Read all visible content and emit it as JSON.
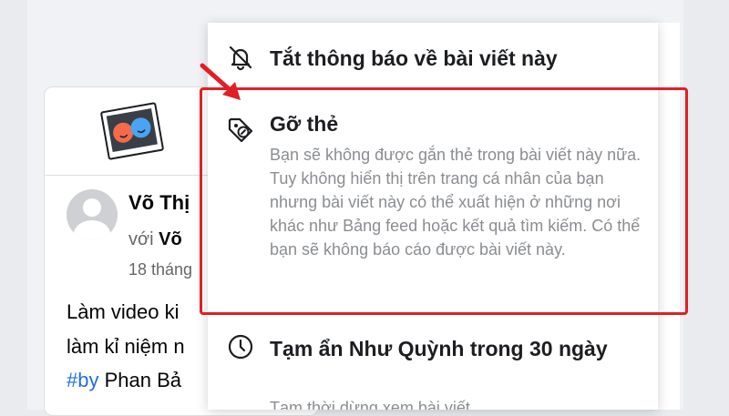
{
  "post": {
    "author": "Võ Thị",
    "with_prefix": "với",
    "with_name": "Võ",
    "date": "18 tháng",
    "text_line1": "Làm video ki",
    "text_line2": "làm kỉ niệm n",
    "hashtag": "#by",
    "text_line3_rest": " Phan Bả"
  },
  "menu": {
    "mute": {
      "title": "Tắt thông báo về bài viết này",
      "icon": "bell-off-icon"
    },
    "untag": {
      "title": "Gỡ thẻ",
      "description": "Bạn sẽ không được gắn thẻ trong bài viết này nữa. Tuy không hiển thị trên trang cá nhân của bạn nhưng bài viết này có thể xuất hiện ở những nơi khác như Bảng feed hoặc kết quả tìm kiếm. Có thể bạn sẽ không báo cáo được bài viết này.",
      "icon": "tag-remove-icon"
    },
    "snooze": {
      "title": "Tạm ẩn Như Quỳnh trong 30 ngày",
      "description": "Tạm thời dừng xem bài viết.",
      "icon": "clock-icon"
    }
  },
  "colors": {
    "highlight": "#e01f26",
    "hashtag": "#216fdb",
    "muted_text": "#8a8d91"
  }
}
